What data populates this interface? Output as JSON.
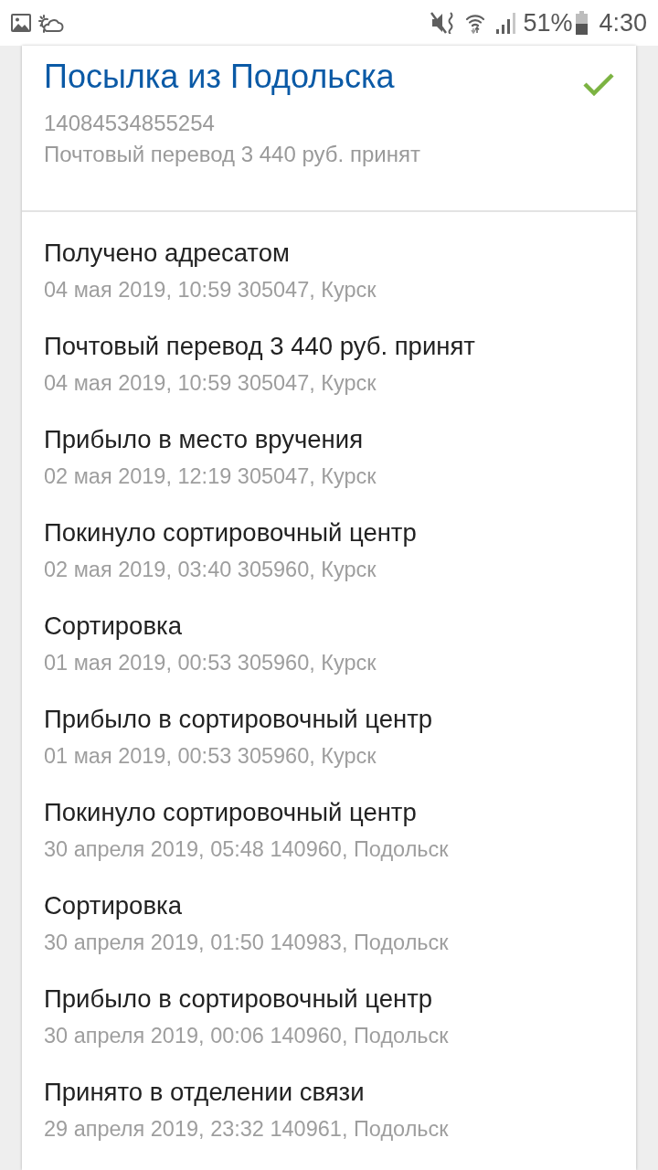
{
  "status_bar": {
    "battery": "51%",
    "time": "4:30"
  },
  "parcel": {
    "title": "Посылка из Подольска",
    "delivered": true,
    "tracking_number": "14084534855254",
    "status": "Почтовый перевод 3 440 руб. принят"
  },
  "events": [
    {
      "title": "Получено адресатом",
      "details": "04 мая 2019, 10:59 305047, Курск"
    },
    {
      "title": "Почтовый перевод 3 440 руб. принят",
      "details": "04 мая 2019, 10:59 305047, Курск"
    },
    {
      "title": "Прибыло в место вручения",
      "details": "02 мая 2019, 12:19 305047, Курск"
    },
    {
      "title": "Покинуло сортировочный центр",
      "details": "02 мая 2019, 03:40 305960, Курск"
    },
    {
      "title": "Сортировка",
      "details": "01 мая 2019, 00:53 305960, Курск"
    },
    {
      "title": "Прибыло в сортировочный центр",
      "details": "01 мая 2019, 00:53 305960, Курск"
    },
    {
      "title": "Покинуло сортировочный центр",
      "details": "30 апреля 2019, 05:48 140960, Подольск"
    },
    {
      "title": "Сортировка",
      "details": "30 апреля 2019, 01:50 140983, Подольск"
    },
    {
      "title": "Прибыло в сортировочный центр",
      "details": "30 апреля 2019, 00:06 140960, Подольск"
    },
    {
      "title": "Принято в отделении связи",
      "details": "29 апреля 2019, 23:32 140961, Подольск"
    }
  ]
}
